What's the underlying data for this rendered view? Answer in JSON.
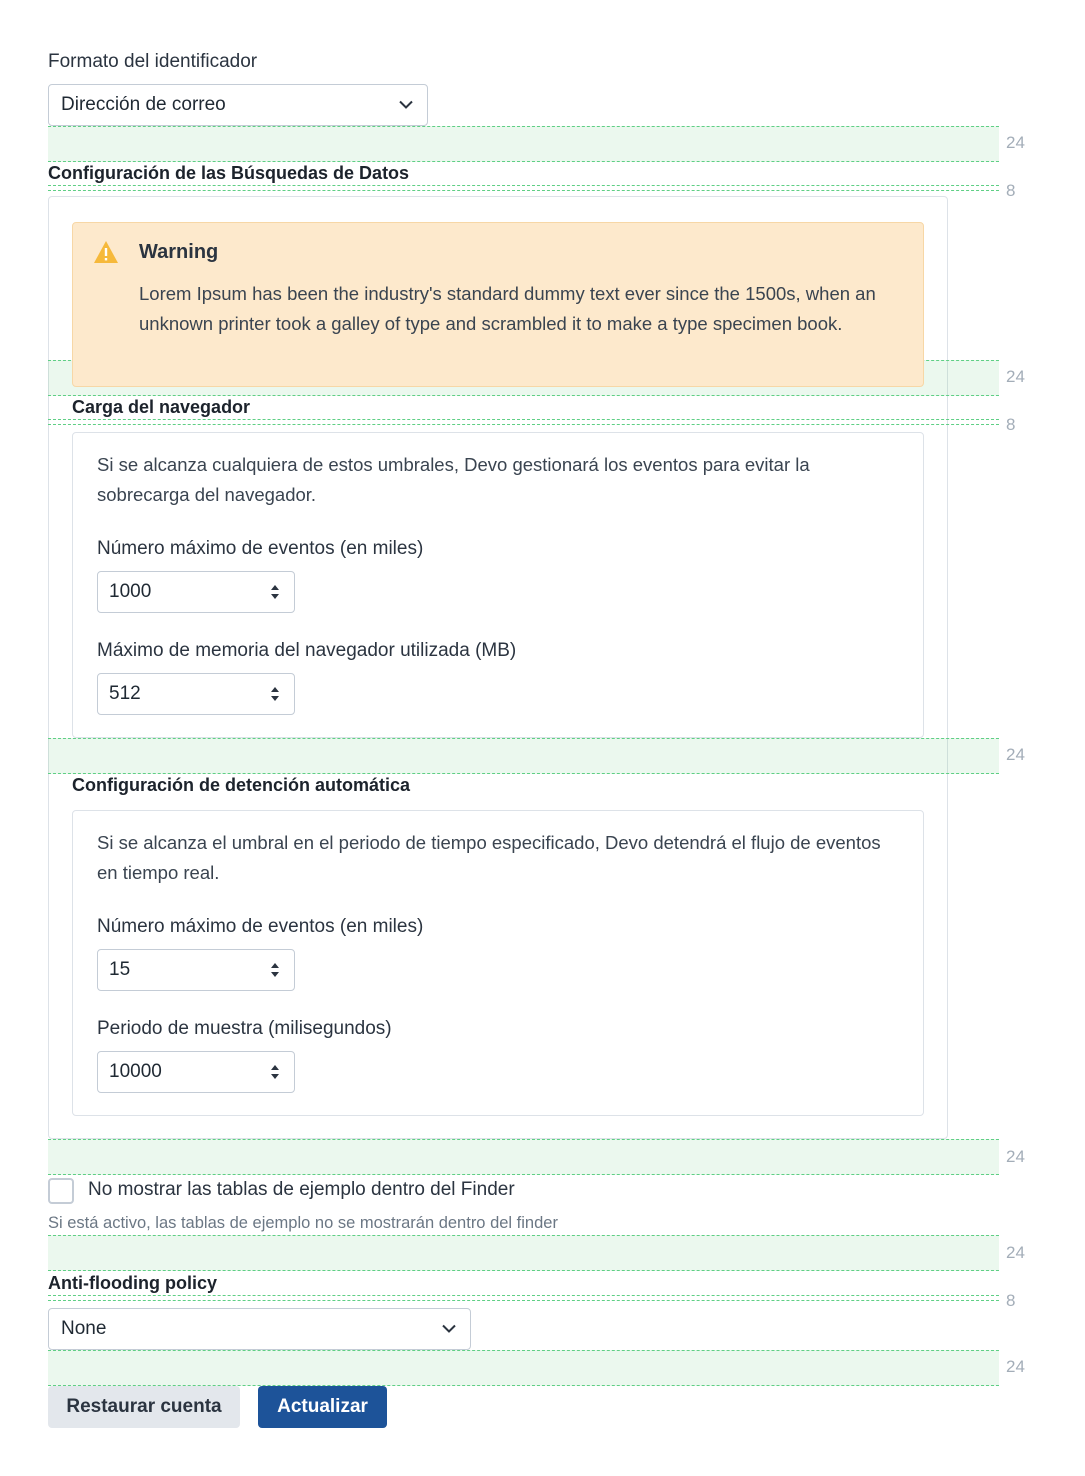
{
  "identifier_format": {
    "label": "Formato del identificador",
    "value": "Dirección de correo",
    "icon": "chevron-down-icon"
  },
  "search_config": {
    "title": "Configuración de las Búsquedas de Datos",
    "warning": {
      "title": "Warning",
      "text": "Lorem Ipsum has been the industry's standard dummy text ever since the 1500s, when an unknown printer took a galley of type and scrambled it to make a type specimen book.",
      "icon": "warning-triangle-icon",
      "color": "#f6b93b"
    },
    "browser_load": {
      "title": "Carga del navegador",
      "description": "Si se alcanza cualquiera de estos umbrales, Devo gestionará los eventos para evitar la sobrecarga del navegador.",
      "max_events_label": "Número máximo de eventos (en miles)",
      "max_events_value": "1000",
      "max_memory_label": "Máximo de memoria del navegador utilizada (MB)",
      "max_memory_value": "512"
    },
    "auto_stop": {
      "title": "Configuración de detención automática",
      "description": "Si se alcanza el umbral en el periodo de tiempo especificado, Devo detendrá el flujo de eventos en tiempo real.",
      "max_events_label": "Número máximo de eventos (en miles)",
      "max_events_value": "15",
      "sample_period_label": "Periodo de muestra (milisegundos)",
      "sample_period_value": "10000"
    }
  },
  "finder_tables": {
    "checkbox_label": "No mostrar las tablas de ejemplo dentro del Finder",
    "help": "Si está activo, las tablas de ejemplo no se mostrarán dentro del finder",
    "checked": false
  },
  "anti_flooding": {
    "title": "Anti-flooding policy",
    "value": "None",
    "icon": "chevron-down-icon"
  },
  "buttons": {
    "restore": "Restaurar cuenta",
    "update": "Actualizar"
  },
  "spacing_labels": {
    "s1": "24",
    "s2": "8",
    "s3": "24",
    "s4": "8",
    "s5": "24",
    "s6": "24",
    "s7": "24",
    "s8": "8",
    "s9": "24"
  },
  "colors": {
    "primary": "#1d5399",
    "secondary_bg": "#e3e7ec",
    "warning_bg": "#fde9cc",
    "spacer_border": "#5fcf85"
  }
}
